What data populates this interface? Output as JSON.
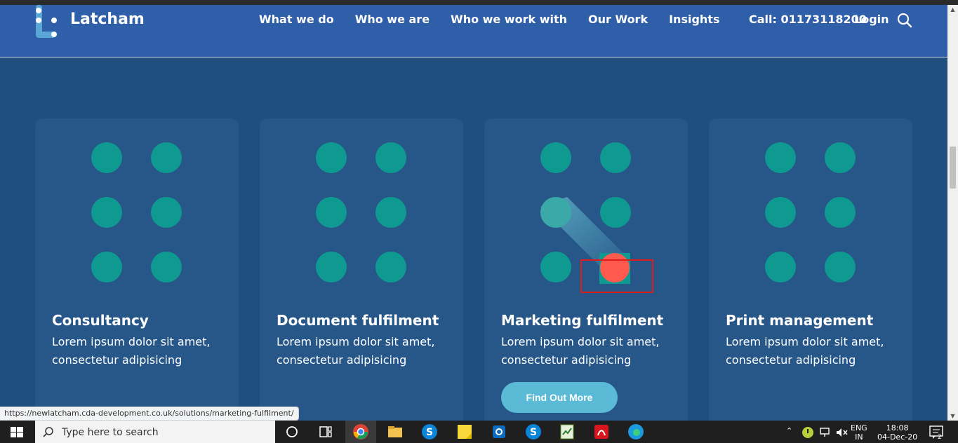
{
  "header": {
    "brand": "Latcham",
    "nav": [
      "What we do",
      "Who we are",
      "Who we work with",
      "Our Work",
      "Insights"
    ],
    "call": "Call: 01173118200",
    "login": "Login"
  },
  "cards": [
    {
      "title": "Consultancy",
      "text": "Lorem ipsum dolor sit amet, consectetur adipisicing"
    },
    {
      "title": "Document fulfilment",
      "text": "Lorem ipsum dolor sit amet, consectetur adipisicing"
    },
    {
      "title": "Marketing fulfilment",
      "text": "Lorem ipsum dolor sit amet, consectetur adipisicing",
      "button": "Find Out More"
    },
    {
      "title": "Print management",
      "text": "Lorem ipsum dolor sit amet, consectetur adipisicing"
    }
  ],
  "status_url": "https://newlatcham.cda-development.co.uk/solutions/marketing-fulfilment/",
  "taskbar": {
    "search_placeholder": "Type here to search",
    "lang_top": "ENG",
    "lang_bottom": "IN",
    "time": "18:08",
    "date": "04-Dec-20",
    "notifications": "2"
  },
  "colors": {
    "header": "#2f5fa8",
    "background": "#1f4e7f",
    "card": "#275789",
    "dot": "#0e9a90",
    "button": "#5bbad5",
    "highlight": "#e01b1b",
    "cursor_dot": "#ff5a4d"
  },
  "icons": [
    "search-icon",
    "windows-start-icon",
    "cortana-icon",
    "task-view-icon",
    "chrome-icon",
    "file-explorer-icon",
    "skype-icon",
    "sticky-notes-icon",
    "outlook-icon",
    "acrobat-icon",
    "edge-icon",
    "wifi-icon",
    "volume-muted-icon",
    "notification-icon"
  ]
}
